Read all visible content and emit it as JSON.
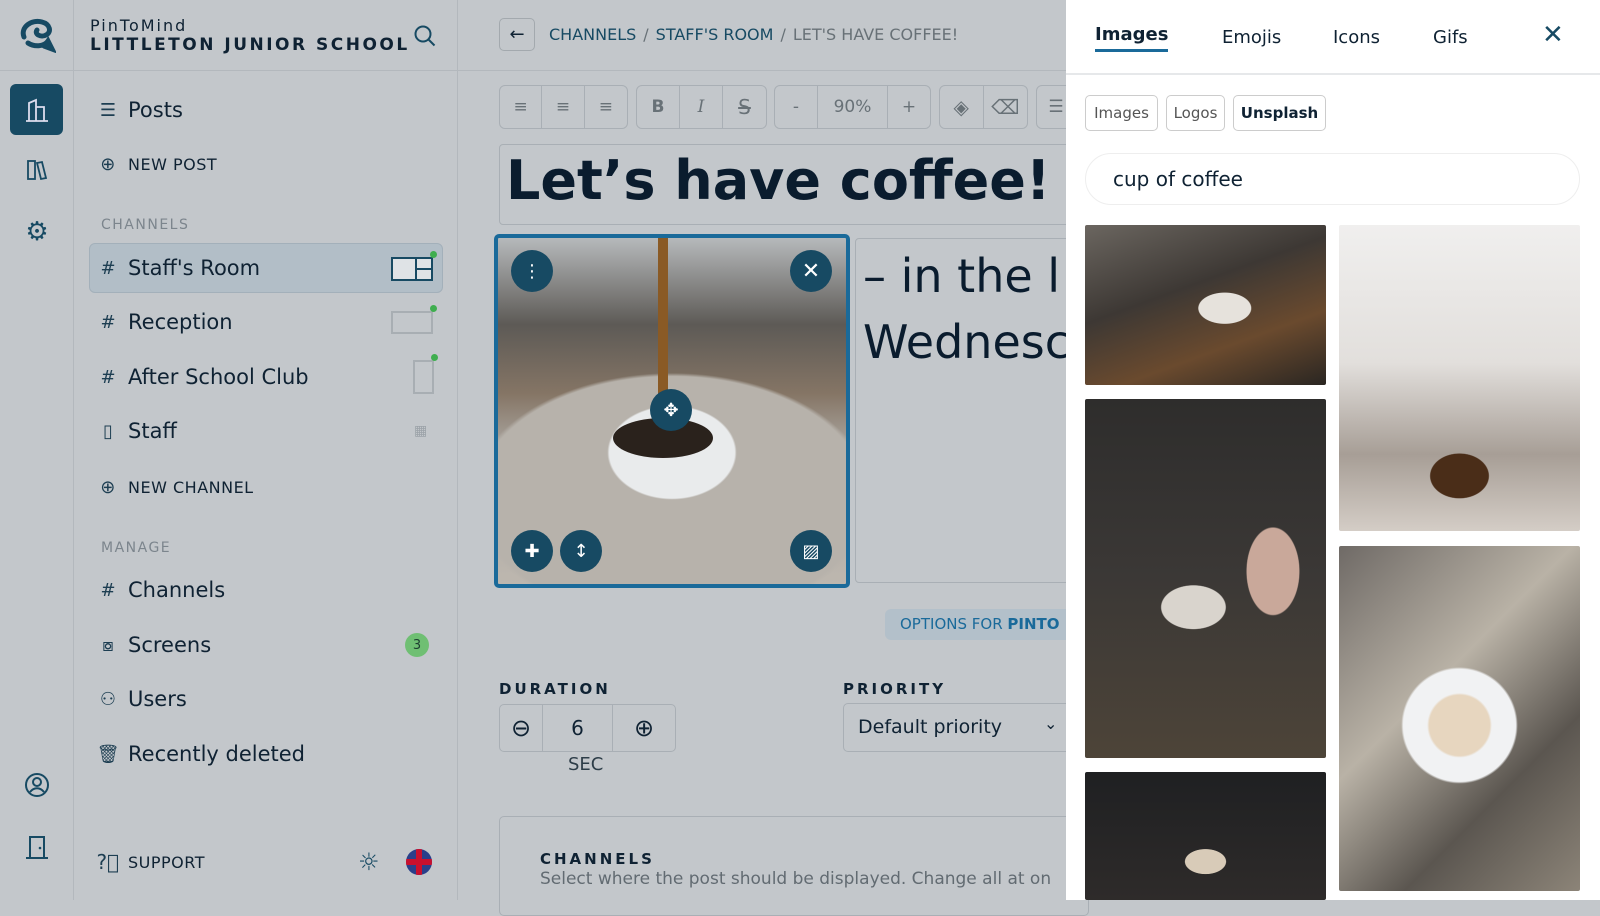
{
  "brand": {
    "app": "PinToMind",
    "org": "LITTLETON JUNIOR SCHOOL"
  },
  "sidebar": {
    "posts": "Posts",
    "new_post": "NEW POST",
    "channels_heading": "CHANNELS",
    "channels": [
      {
        "label": "Staff's Room",
        "icon": "hash"
      },
      {
        "label": "Reception",
        "icon": "hash"
      },
      {
        "label": "After School Club",
        "icon": "hash"
      },
      {
        "label": "Staff",
        "icon": "phone"
      }
    ],
    "new_channel": "NEW CHANNEL",
    "manage_heading": "MANAGE",
    "manage": [
      {
        "label": "Channels"
      },
      {
        "label": "Screens",
        "badge": "3"
      },
      {
        "label": "Users"
      },
      {
        "label": "Recently deleted"
      }
    ],
    "support": "SUPPORT"
  },
  "breadcrumb": {
    "items": [
      "CHANNELS",
      "STAFF'S ROOM"
    ],
    "current": "LET'S HAVE COFFEE!",
    "sep": "/"
  },
  "toolbar": {
    "bold": "B",
    "italic": "I",
    "minus": "-",
    "zoom": "90%",
    "plus": "+"
  },
  "post": {
    "title": "Let’s have coffee!",
    "body_line1": "– in the l",
    "body_line2": "Wednesc"
  },
  "options": {
    "prefix": "OPTIONS FOR ",
    "name": "PINTO"
  },
  "duration": {
    "label": "DURATION",
    "value": "6",
    "unit": "SEC"
  },
  "priority": {
    "label": "PRIORITY",
    "value": "Default priority"
  },
  "channels_box": {
    "label": "CHANNELS",
    "desc": "Select where the post should be displayed. Change all at on"
  },
  "panel": {
    "tabs": [
      "Images",
      "Emojis",
      "Icons",
      "Gifs"
    ],
    "active_tab": "Images",
    "sources": [
      "Images",
      "Logos",
      "Unsplash"
    ],
    "active_source": "Unsplash",
    "search": "cup of coffee"
  },
  "colors": {
    "accent": "#1a6a9a",
    "dark": "#174a63",
    "badge": "#6fbf73"
  }
}
